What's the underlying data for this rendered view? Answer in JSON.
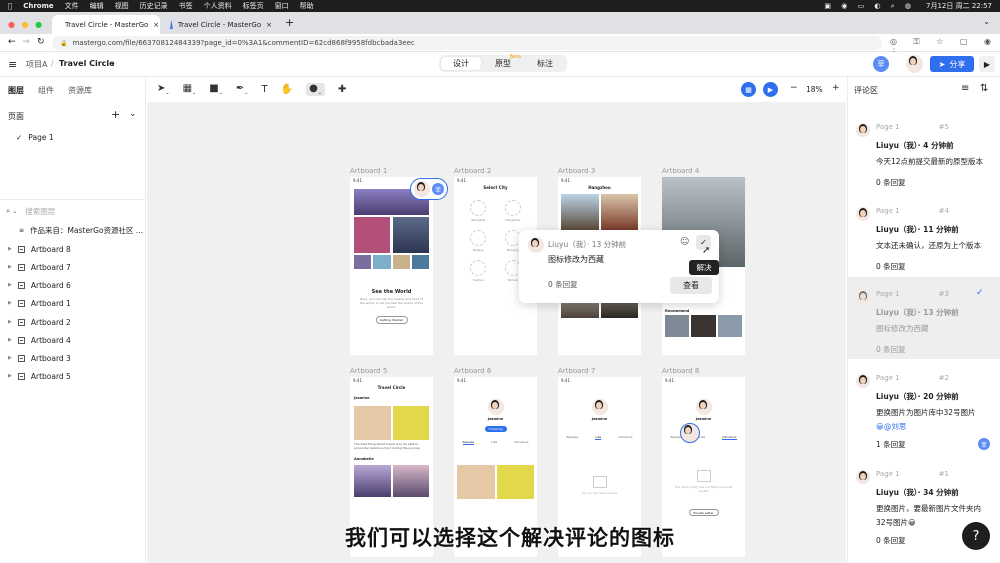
{
  "os_menubar": {
    "app": "Chrome",
    "items": [
      "文件",
      "编辑",
      "视图",
      "历史记录",
      "书签",
      "个人资料",
      "标签页",
      "窗口",
      "帮助"
    ],
    "clock": "7月12日 周二 22:57"
  },
  "browser": {
    "tabs": [
      {
        "title": "Travel Circle - MasterGo"
      },
      {
        "title": "Travel Circle - MasterGo"
      }
    ],
    "url": "mastergo.com/file/66370812484339?page_id=0%3A1&commentID=62cd868f9958fdbcbada3eec"
  },
  "header": {
    "project": "项目A",
    "separator": "/",
    "file": "Travel Circle",
    "modes": [
      "设计",
      "原型",
      "标注"
    ],
    "beta_label": "Beta",
    "share_label": "分享",
    "user_initial": "菲"
  },
  "left_panel": {
    "tabs": [
      "图层",
      "组件",
      "资源库"
    ],
    "pages_title": "页面",
    "pages": [
      "Page 1"
    ],
    "search_placeholder": "搜索图层",
    "source_item": "作品来自：MasterGo资源社区 ...",
    "layers": [
      "Artboard 8",
      "Artboard 7",
      "Artboard 6",
      "Artboard 1",
      "Artboard 2",
      "Artboard 4",
      "Artboard 3",
      "Artboard 5"
    ]
  },
  "toolbar": {
    "zoom": "18%",
    "right_title": "评论区"
  },
  "canvas": {
    "artboard_labels": [
      "Artboard 1",
      "Artboard 2",
      "Artboard 3",
      "Artboard 4",
      "Artboard 5",
      "Artboard 6",
      "Artboard 7",
      "Artboard 8"
    ],
    "artboard1": {
      "time": "9:41",
      "title": "See the World",
      "body": "Here, you can see the beauty and front of the world, to let you feel the charm of the world.",
      "button": "Getting Started"
    },
    "artboard2": {
      "title": "Select City",
      "cities": [
        "Shanghai",
        "Hangzhou",
        "Beijing",
        "Nanjing",
        "Suzhou",
        "Wuhan"
      ]
    },
    "artboard3": {
      "title": "Hangzhou"
    },
    "artboard4": {
      "label": "Recommend"
    },
    "artboard5": {
      "title": "Travel Circle",
      "user": "Jasmine",
      "text": "The best thing about travel is to be able to encounter delicious food during the journey.",
      "user2": "Annabelle"
    },
    "artboard6": {
      "user": "Jasmine",
      "button": "Following",
      "tabs": [
        "Release",
        "Like",
        "Introduce"
      ]
    },
    "artboard7": {
      "user": "Jasmine",
      "tabs": [
        "Release",
        "Like",
        "Introduce"
      ],
      "empty": "You do not have access"
    },
    "artboard8": {
      "user": "Jasmine",
      "tabs": [
        "Release",
        "Like",
        "Introduce"
      ],
      "empty": "The other party has not filled personal profile",
      "button": "Private Letter"
    },
    "comment_marker_badge": "菲"
  },
  "popup": {
    "author": "Liuyu（我）· 13 分钟前",
    "text": "图标修改为西藏",
    "replies": "0 条回复",
    "view_button": "查看",
    "tooltip": "解决"
  },
  "comments": [
    {
      "page": "Page 1",
      "num": "#5",
      "author": "Liuyu（我）· 4 分钟前",
      "text": "今天12点前提交最新的原型版本",
      "replies": "0 条回复",
      "resolved": false
    },
    {
      "page": "Page 1",
      "num": "#4",
      "author": "Liuyu（我）· 11 分钟前",
      "text": "文本还未确认，还原为上个版本",
      "replies": "0 条回复",
      "resolved": false
    },
    {
      "page": "Page 1",
      "num": "#3",
      "author": "Liuyu（我）· 13 分钟前",
      "text": "图标修改为西藏",
      "replies": "0 条回复",
      "resolved": true
    },
    {
      "page": "Page 1",
      "num": "#2",
      "author": "Liuyu（我）· 20 分钟前",
      "text": "更换图片为图片库中32号图片",
      "mention": "@刘思",
      "replies": "1 条回复",
      "resolved": false
    },
    {
      "page": "Page 1",
      "num": "#1",
      "author": "Liuyu（我）· 34 分钟前",
      "text": "更换图片，要最新图片文件夹内",
      "text2": "32号图片",
      "replies": "0 条回复",
      "resolved": false
    }
  ],
  "help_button": "?",
  "subtitle": "我们可以选择这个解决评论的图标",
  "colors": {
    "accent": "#2f6fed",
    "menubar": "#1e1e1e",
    "canvas": "#f0f0f0"
  }
}
